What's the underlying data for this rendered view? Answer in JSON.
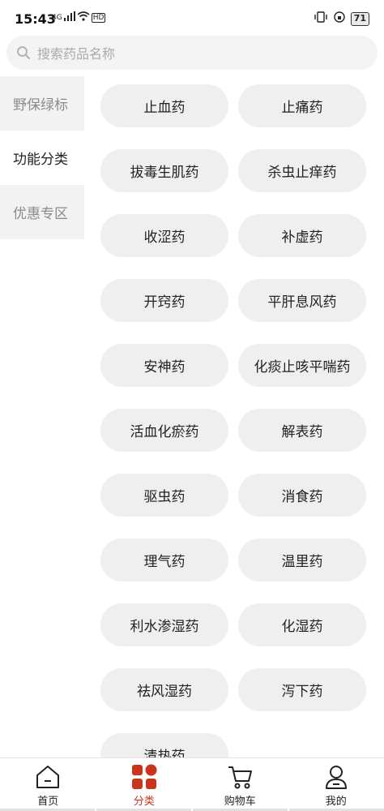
{
  "status": {
    "time": "15:43",
    "net": "4G",
    "hd": "HD",
    "battery": "71"
  },
  "search": {
    "placeholder": "搜索药品名称"
  },
  "sidebar": {
    "items": [
      {
        "label": "野保绿标"
      },
      {
        "label": "功能分类"
      },
      {
        "label": "优惠专区"
      }
    ]
  },
  "categories": [
    "止血药",
    "止痛药",
    "拔毒生肌药",
    "杀虫止痒药",
    "收涩药",
    "补虚药",
    "开窍药",
    "平肝息风药",
    "安神药",
    "化痰止咳平喘药",
    "活血化瘀药",
    "解表药",
    "驱虫药",
    "消食药",
    "理气药",
    "温里药",
    "利水渗湿药",
    "化湿药",
    "祛风湿药",
    "泻下药",
    "清热药"
  ],
  "tabbar": {
    "items": [
      {
        "label": "首页",
        "icon": "home-icon"
      },
      {
        "label": "分类",
        "icon": "category-icon"
      },
      {
        "label": "购物车",
        "icon": "cart-icon"
      },
      {
        "label": "我的",
        "icon": "profile-icon"
      }
    ],
    "active_color": "#c8341c"
  }
}
